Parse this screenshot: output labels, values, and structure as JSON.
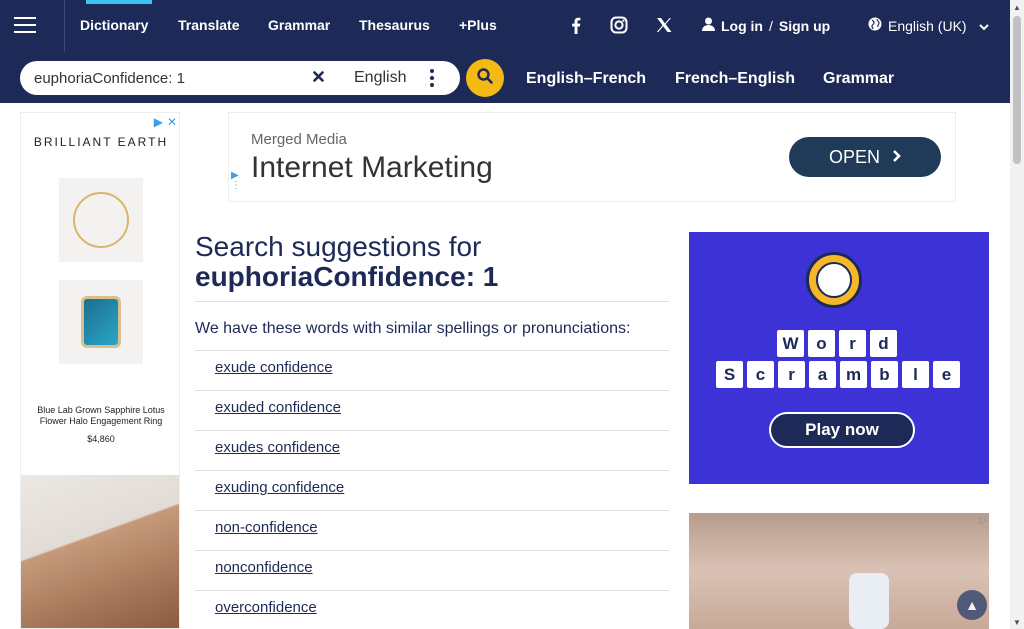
{
  "nav": {
    "dictionary": "Dictionary",
    "translate": "Translate",
    "grammar": "Grammar",
    "thesaurus": "Thesaurus",
    "plus": "+Plus",
    "login": "Log in",
    "separator": "/",
    "signup": "Sign up",
    "language": "English (UK)"
  },
  "search": {
    "value": "euphoriaConfidence: 1",
    "dictionary": "English"
  },
  "subnav": {
    "english_french": "English–French",
    "french_english": "French–English",
    "grammar": "Grammar"
  },
  "left_ad": {
    "brand": "BRILLIANT EARTH",
    "caption": "Blue Lab Grown Sapphire Lotus Flower Halo Engagement Ring",
    "price": "$4,860"
  },
  "banner_ad": {
    "small": "Merged Media",
    "big": "Internet Marketing",
    "button": "OPEN"
  },
  "main": {
    "heading_prefix": "Search suggestions for",
    "heading_query": "euphoriaConfidence: 1",
    "intro": "We have these words with similar spellings or pronunciations:",
    "suggestions": [
      "exude confidence",
      "exuded confidence",
      "exudes confidence",
      "exuding confidence",
      "non-confidence",
      "nonconfidence",
      "overconfidence"
    ]
  },
  "right_ad": {
    "word1": [
      "W",
      "o",
      "r",
      "d"
    ],
    "word2": [
      "S",
      "c",
      "r",
      "a",
      "m",
      "b",
      "l",
      "e"
    ],
    "button": "Play now"
  },
  "colors": {
    "navy": "#1d2a57",
    "accent_yellow": "#f5b914",
    "active_tab": "#3cc3f2",
    "scramble_bg": "#3d32d6"
  },
  "icons": [
    "menu-icon",
    "facebook-icon",
    "instagram-icon",
    "x-icon",
    "user-icon",
    "globe-icon",
    "chevron-down-icon",
    "clear-icon",
    "more-vertical-icon",
    "search-icon",
    "ad-choices-icon",
    "close-icon",
    "chevron-right-icon",
    "arrow-up-icon"
  ]
}
